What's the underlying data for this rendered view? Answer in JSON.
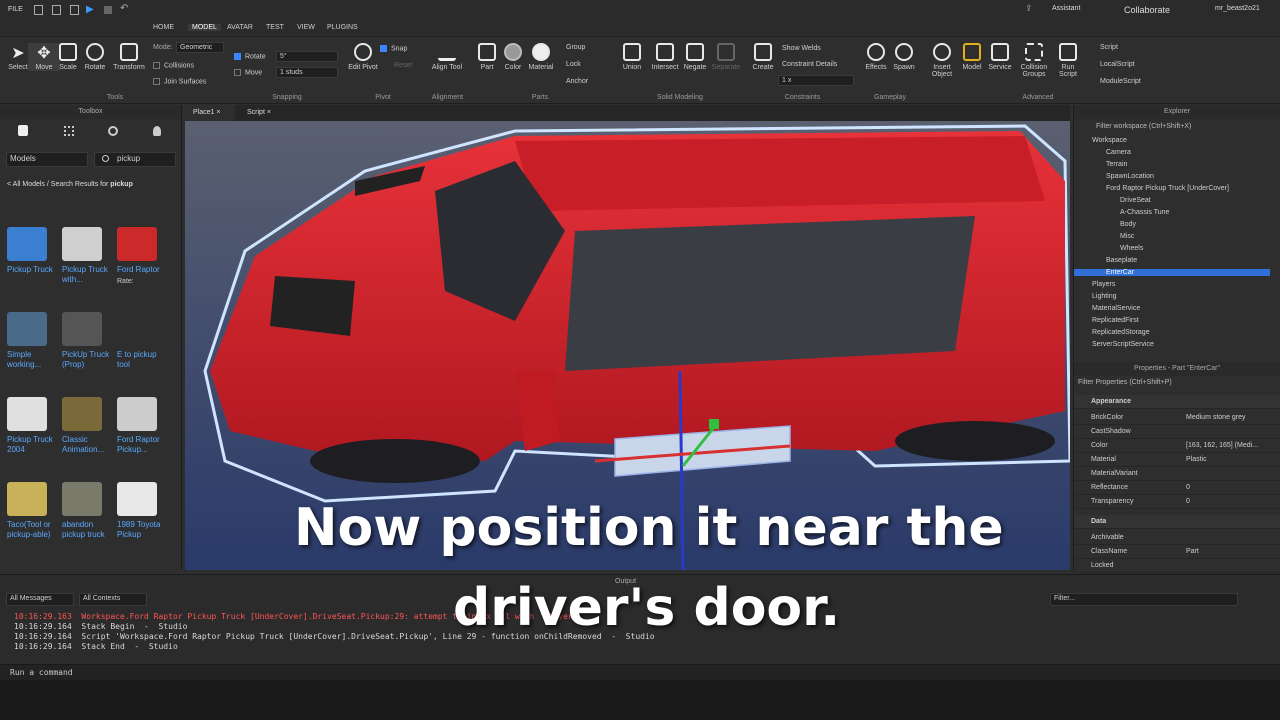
{
  "topbar": {
    "file": "FILE",
    "menus": [
      "HOME",
      "MODEL",
      "AVATAR",
      "TEST",
      "VIEW",
      "PLUGINS"
    ],
    "assistant": "Assistant",
    "collaborate": "Collaborate",
    "user": "mr_beast2o21"
  },
  "ribbon": {
    "tools": [
      "Select",
      "Move",
      "Scale",
      "Rotate",
      "Transform"
    ],
    "tools_group": "Tools",
    "mode_label": "Mode:",
    "mode_value": "Geometric",
    "collisions": "Collisions",
    "join_surfaces": "Join Surfaces",
    "rotate_label": "Rotate",
    "rotate_value": "5°",
    "move_label": "Move",
    "move_value": "1 studs",
    "snapping_group": "Snapping",
    "edit_pivot": "Edit Pivot",
    "snap": "Snap",
    "reset": "Reset",
    "pivot_group": "Pivot",
    "align_tool": "Align Tool",
    "alignment_group": "Alignment",
    "part": "Part",
    "color": "Color",
    "material": "Material",
    "group": "Group",
    "lock": "Lock",
    "anchor": "Anchor",
    "parts_group": "Parts",
    "union": "Union",
    "intersect": "Intersect",
    "negate": "Negate",
    "separate": "Separate",
    "solid_group": "Solid Modeling",
    "create": "Create",
    "show_welds": "Show Welds",
    "constraint_details": "Constraint Details",
    "scale_value": "1 x",
    "constraints_group": "Constraints",
    "effects": "Effects",
    "spawn": "Spawn",
    "gameplay_group": "Gameplay",
    "insert_object": "Insert Object",
    "model": "Model",
    "service": "Service",
    "collision_groups": "Collision Groups",
    "run_script": "Run Script",
    "script": "Script",
    "local_script": "LocalScript",
    "module_script": "ModuleScript",
    "advanced_group": "Advanced"
  },
  "toolbox": {
    "title": "Toolbox",
    "category": "Models",
    "search": "pickup",
    "breadcrumb_prefix": "< All Models / Search Results for ",
    "breadcrumb_term": "pickup",
    "items": [
      {
        "name": "Pickup Truck",
        "color": "#3b7fd1"
      },
      {
        "name": "Pickup Truck with...",
        "color": "#cfcfcf"
      },
      {
        "name": "Ford Raptor",
        "color": "#cc2a2a"
      },
      {
        "name": "Simple working...",
        "color": "#4a6a8a"
      },
      {
        "name": "PickUp Truck (Prop)",
        "color": "#555555"
      },
      {
        "name": "E to pickup tool",
        "color": "#2e2e2e"
      },
      {
        "name": "Pickup Truck 2004",
        "color": "#e0e0e0"
      },
      {
        "name": "Classic Animation...",
        "color": "#7a6a3a"
      },
      {
        "name": "Ford Raptor Pickup...",
        "color": "#cccccc"
      },
      {
        "name": "Taco(Tool or pickup-able)",
        "color": "#c9b15a"
      },
      {
        "name": "abandon pickup truck",
        "color": "#7a7a6a"
      },
      {
        "name": "1989 Toyota Pickup",
        "color": "#e8e8e8"
      }
    ],
    "rate_label": "Rate:"
  },
  "tabs": {
    "place": "Place1",
    "script": "Script"
  },
  "explorer": {
    "title": "Explorer",
    "filter": "Filter workspace (Ctrl+Shift+X)",
    "items": [
      {
        "label": "Workspace",
        "indent": 0
      },
      {
        "label": "Camera",
        "indent": 1
      },
      {
        "label": "Terrain",
        "indent": 1
      },
      {
        "label": "SpawnLocation",
        "indent": 1
      },
      {
        "label": "Ford Raptor Pickup Truck [UnderCover]",
        "indent": 1
      },
      {
        "label": "DriveSeat",
        "indent": 2
      },
      {
        "label": "A-Chassis Tune",
        "indent": 2
      },
      {
        "label": "Body",
        "indent": 2
      },
      {
        "label": "Misc",
        "indent": 2
      },
      {
        "label": "Wheels",
        "indent": 2
      },
      {
        "label": "Baseplate",
        "indent": 1
      },
      {
        "label": "EnterCar",
        "indent": 1,
        "selected": true
      },
      {
        "label": "Players",
        "indent": 0
      },
      {
        "label": "Lighting",
        "indent": 0
      },
      {
        "label": "MaterialService",
        "indent": 0
      },
      {
        "label": "ReplicatedFirst",
        "indent": 0
      },
      {
        "label": "ReplicatedStorage",
        "indent": 0
      },
      {
        "label": "ServerScriptService",
        "indent": 0
      }
    ]
  },
  "properties": {
    "title": "Properties - Part \"EnterCar\"",
    "filter": "Filter Properties (Ctrl+Shift+P)",
    "appearance": "Appearance",
    "data": "Data",
    "rows": [
      {
        "k": "BrickColor",
        "v": "Medium stone grey"
      },
      {
        "k": "CastShadow",
        "v": ""
      },
      {
        "k": "Color",
        "v": "[163, 162, 165] (Medi..."
      },
      {
        "k": "Material",
        "v": "Plastic"
      },
      {
        "k": "MaterialVariant",
        "v": ""
      },
      {
        "k": "Reflectance",
        "v": "0"
      },
      {
        "k": "Transparency",
        "v": "0"
      }
    ],
    "data_rows": [
      {
        "k": "Archivable",
        "v": ""
      },
      {
        "k": "ClassName",
        "v": "Part"
      },
      {
        "k": "Locked",
        "v": ""
      }
    ]
  },
  "output": {
    "title": "Output",
    "all_messages": "All Messages",
    "all_contexts": "All Contexts",
    "filter": "Filter...",
    "lines": [
      {
        "text": "10:16:29.163  Workspace.Ford Raptor Pickup Truck [UnderCover].DriveSeat.Pickup:29: attempt to index nil with 'Player'",
        "err": true
      },
      {
        "text": "10:16:29.164  Stack Begin  -  Studio",
        "err": false
      },
      {
        "text": "10:16:29.164  Script 'Workspace.Ford Raptor Pickup Truck [UnderCover].DriveSeat.Pickup', Line 29 - function onChildRemoved  -  Studio",
        "err": false
      },
      {
        "text": "10:16:29.164  Stack End  -  Studio",
        "err": false
      }
    ],
    "command": "Run a command"
  },
  "captions": {
    "line1": "Now position it near the",
    "line2": "driver's door."
  }
}
